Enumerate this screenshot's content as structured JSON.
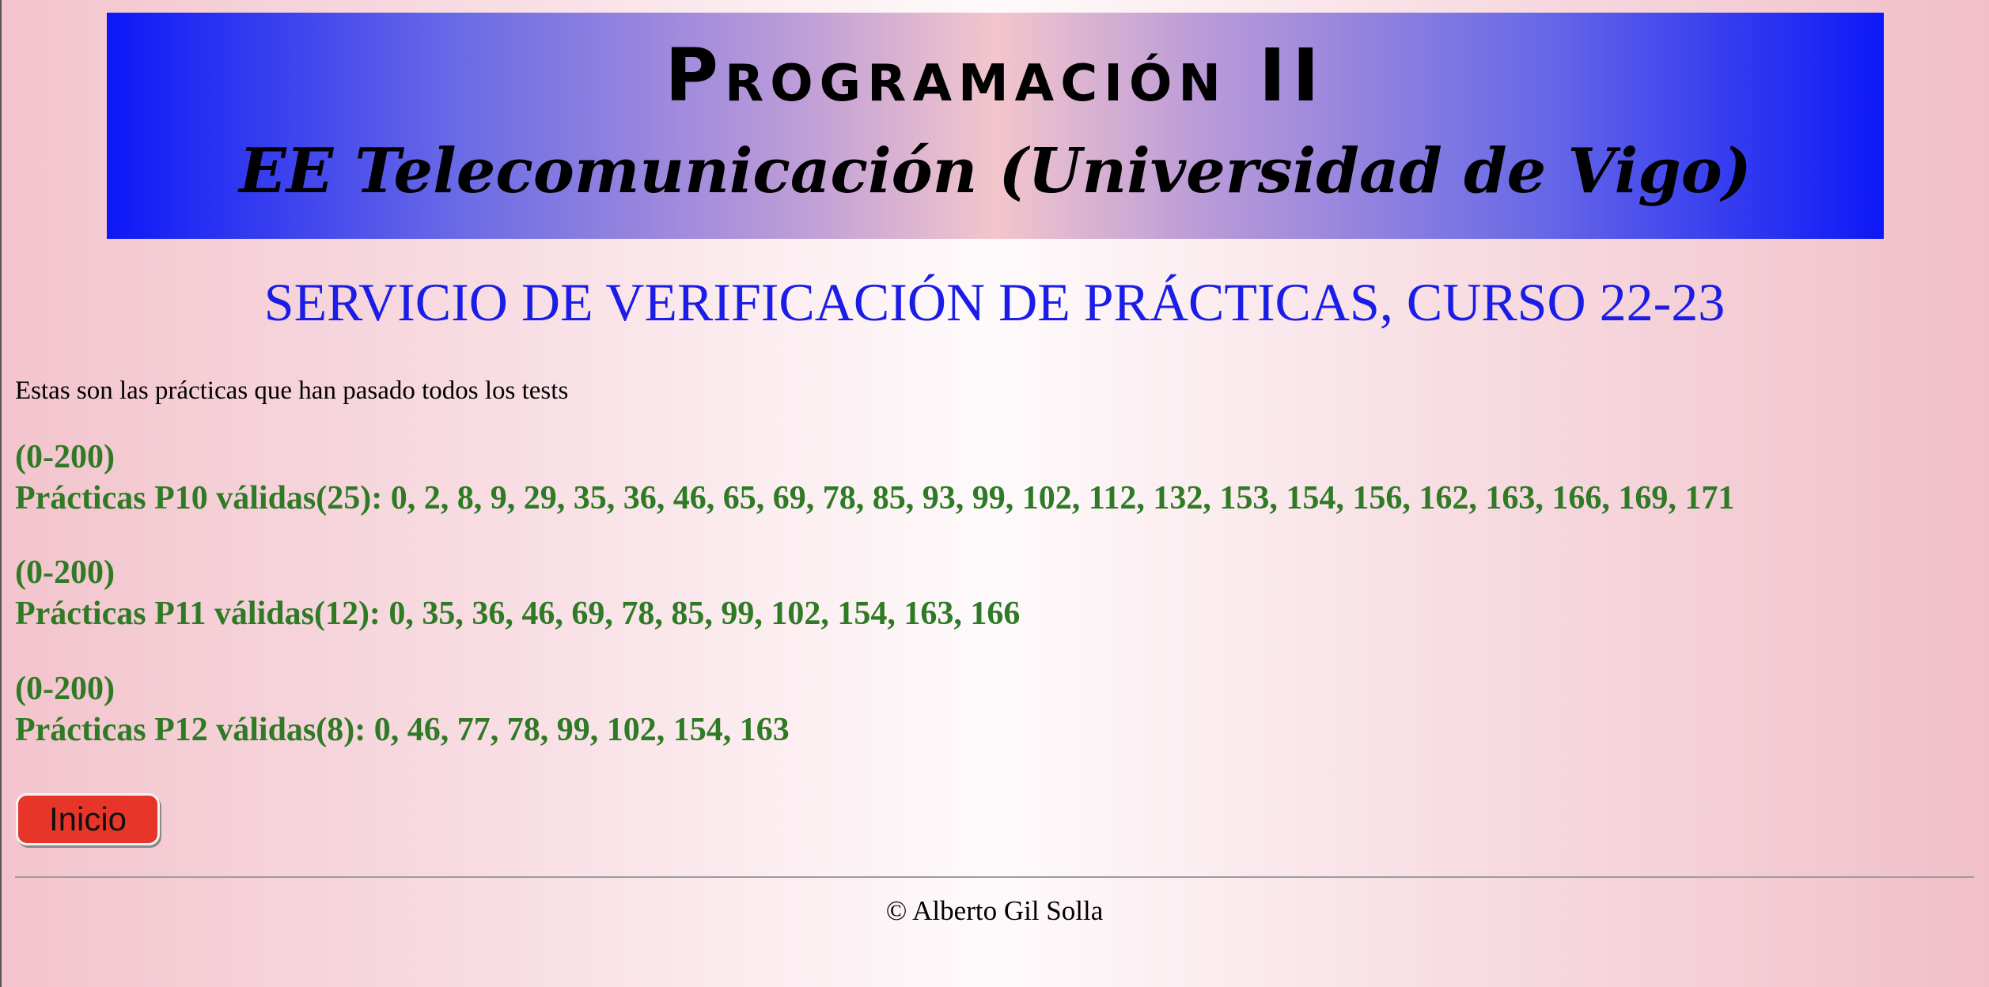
{
  "banner": {
    "title": "Programación II",
    "subtitle": "EE Telecomunicación (Universidad de Vigo)"
  },
  "page_heading": "SERVICIO DE VERIFICACIÓN DE PRÁCTICAS, CURSO 22-23",
  "intro": "Estas son las prácticas que han pasado todos los tests",
  "sections": [
    {
      "range": "(0-200)",
      "summary": "Prácticas P10 válidas(25): 0, 2, 8, 9, 29, 35, 36, 46, 65, 69, 78, 85, 93, 99, 102, 112, 132, 153, 154, 156, 162, 163, 166, 169, 171"
    },
    {
      "range": "(0-200)",
      "summary": "Prácticas P11 válidas(12): 0, 35, 36, 46, 69, 78, 85, 99, 102, 154, 163, 166"
    },
    {
      "range": "(0-200)",
      "summary": "Prácticas P12 válidas(8): 0, 46, 77, 78, 99, 102, 154, 163"
    }
  ],
  "buttons": {
    "inicio_label": "Inicio"
  },
  "footer": "© Alberto Gil Solla",
  "colors": {
    "banner_edge": "#0c18f7",
    "heading": "#1b1de6",
    "results_text": "#2f7a25",
    "button_bg": "#e8352a"
  }
}
